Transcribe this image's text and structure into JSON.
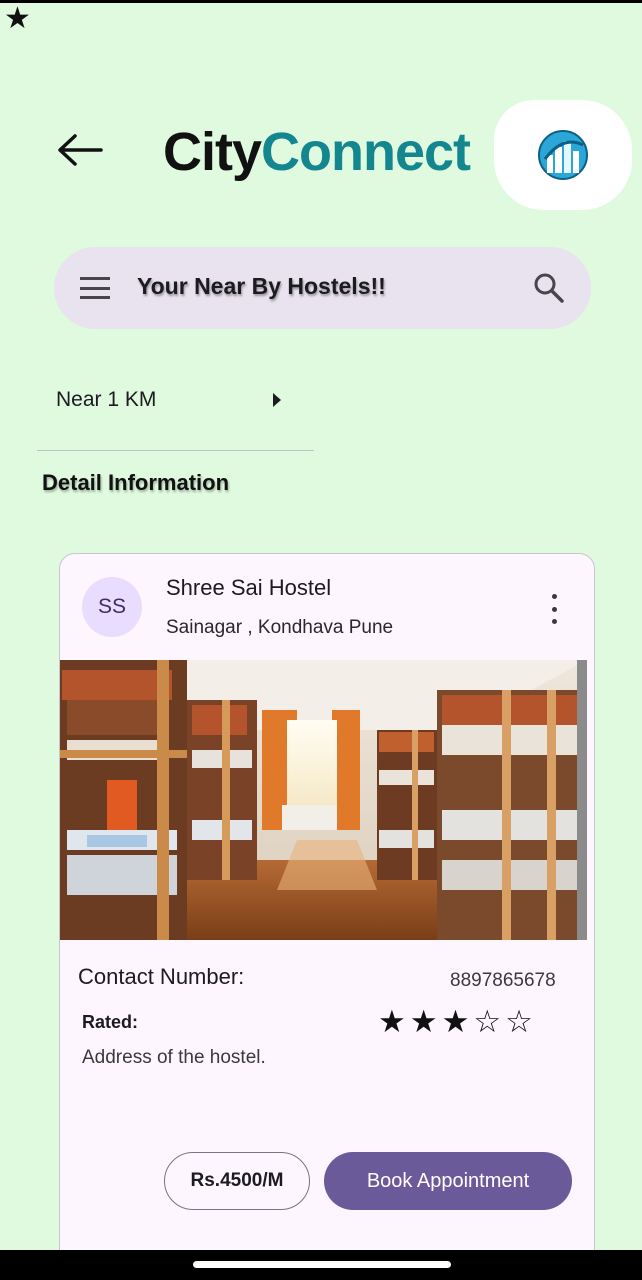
{
  "status_bar": {
    "icon": "star-icon"
  },
  "header": {
    "back_icon": "arrow-left-icon",
    "logo_part1": "City",
    "logo_part2": "Connect",
    "logo_badge_icon": "city-logo-icon",
    "colors": {
      "logo_dark": "#111111",
      "logo_teal": "#14868f"
    }
  },
  "search": {
    "menu_icon": "hamburger-menu-icon",
    "title": "Your Near By Hostels!!",
    "search_icon": "search-icon"
  },
  "filter": {
    "label": "Near 1 KM",
    "arrow_icon": "triangle-right-icon"
  },
  "section_title": "Detail Information",
  "card": {
    "avatar_initials": "SS",
    "title": "Shree Sai Hostel",
    "subtitle": "Sainagar , Kondhava Pune",
    "more_icon": "more-vert-icon",
    "image_description_icon": "hostel-dormitory-photo",
    "contact_label": "Contact Number:",
    "contact_value": "8897865678",
    "rated_label": "Rated:",
    "rating_stars": "★★★☆☆",
    "rating": {
      "value": 3,
      "max": 5
    },
    "address": "Address of the hostel.",
    "price_label": "Rs.4500/M",
    "book_label": "Book Appointment",
    "colors": {
      "accent": "#6a5a99",
      "background": "#fdf6fe",
      "page_background": "#dffadf"
    }
  }
}
